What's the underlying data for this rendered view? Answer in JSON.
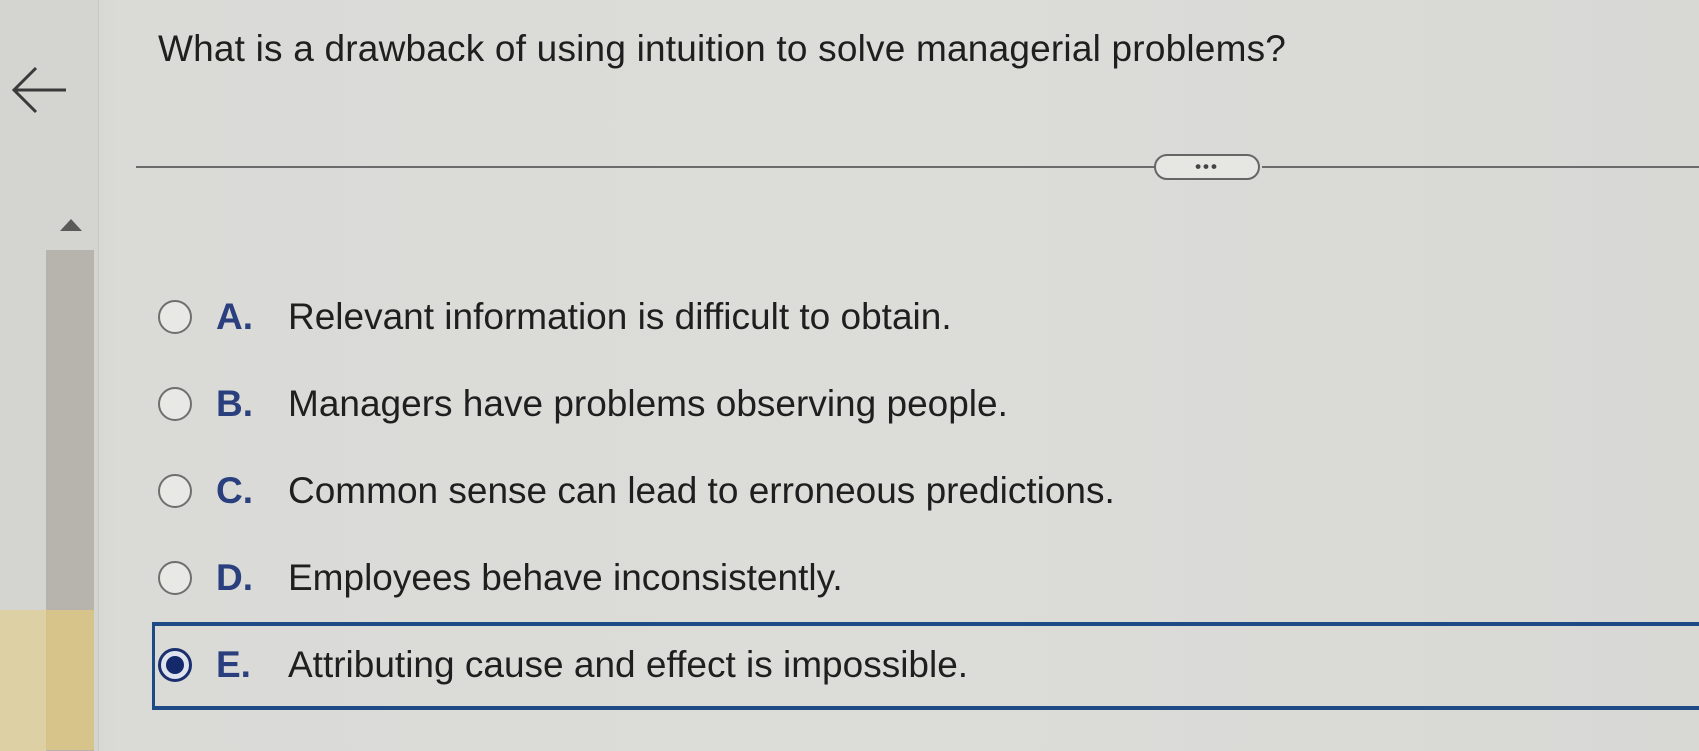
{
  "question": {
    "text": "What is a drawback of using intuition to solve managerial problems?"
  },
  "toolbar": {
    "more_label": "•••"
  },
  "options": [
    {
      "letter": "A.",
      "text": "Relevant information is difficult to obtain.",
      "selected": false
    },
    {
      "letter": "B.",
      "text": "Managers have problems observing people.",
      "selected": false
    },
    {
      "letter": "C.",
      "text": "Common sense can lead to erroneous predictions.",
      "selected": false
    },
    {
      "letter": "D.",
      "text": "Employees behave inconsistently.",
      "selected": false
    },
    {
      "letter": "E.",
      "text": "Attributing cause and effect is impossible.",
      "selected": true
    }
  ],
  "icons": {
    "back": "arrow-left-icon",
    "scroll_up": "triangle-up-icon"
  },
  "colors": {
    "accent": "#1e4a86",
    "letter": "#2a3f7d",
    "background": "#dcdcd9"
  }
}
